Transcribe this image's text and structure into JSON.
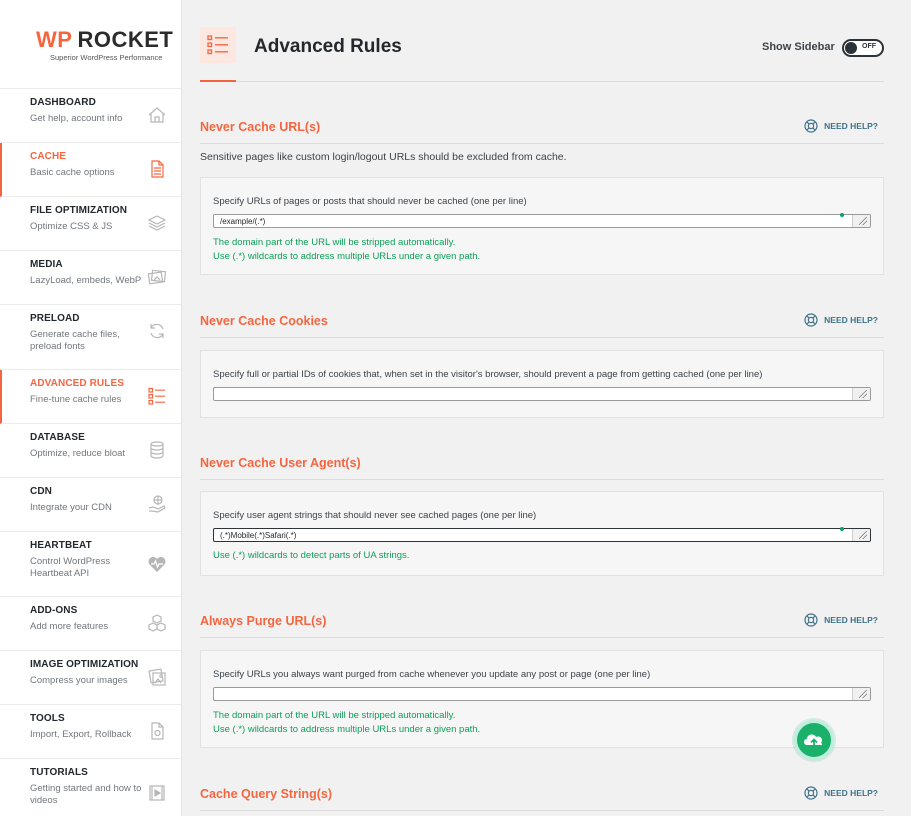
{
  "logo": {
    "brand_wp": "WP",
    "brand_rocket": "ROCKET",
    "tagline": "Superior WordPress Performance"
  },
  "sidebar": {
    "items": [
      {
        "title": "DASHBOARD",
        "desc": "Get help, account info",
        "icon": "home-icon"
      },
      {
        "title": "CACHE",
        "desc": "Basic cache options",
        "icon": "document-icon"
      },
      {
        "title": "FILE OPTIMIZATION",
        "desc": "Optimize CSS & JS",
        "icon": "layers-icon"
      },
      {
        "title": "MEDIA",
        "desc": "LazyLoad, embeds, WebP",
        "icon": "images-icon"
      },
      {
        "title": "PRELOAD",
        "desc": "Generate cache files, preload fonts",
        "icon": "refresh-icon"
      },
      {
        "title": "ADVANCED RULES",
        "desc": "Fine-tune cache rules",
        "icon": "checklist-icon"
      },
      {
        "title": "DATABASE",
        "desc": "Optimize, reduce bloat",
        "icon": "database-icon"
      },
      {
        "title": "CDN",
        "desc": "Integrate your CDN",
        "icon": "cdn-hand-icon"
      },
      {
        "title": "HEARTBEAT",
        "desc": "Control WordPress Heartbeat API",
        "icon": "heartbeat-icon"
      },
      {
        "title": "ADD-ONS",
        "desc": "Add more features",
        "icon": "cubes-icon"
      },
      {
        "title": "IMAGE OPTIMIZATION",
        "desc": "Compress your images",
        "icon": "image-optimize-icon"
      },
      {
        "title": "TOOLS",
        "desc": "Import, Export, Rollback",
        "icon": "tools-file-icon"
      },
      {
        "title": "TUTORIALS",
        "desc": "Getting started and how to videos",
        "icon": "video-icon"
      }
    ]
  },
  "header": {
    "title": "Advanced Rules",
    "show_sidebar_label": "Show Sidebar",
    "toggle_state": "OFF"
  },
  "help_label": "NEED HELP?",
  "sections": {
    "never_cache_urls": {
      "title": "Never Cache URL(s)",
      "desc": "Sensitive pages like custom login/logout URLs should be excluded from cache.",
      "field_label": "Specify URLs of pages or posts that should never be cached (one per line)",
      "value": "/example/(.*)",
      "note1": "The domain part of the URL will be stripped automatically.",
      "note2": "Use (.*) wildcards to address multiple URLs under a given path."
    },
    "never_cache_cookies": {
      "title": "Never Cache Cookies",
      "field_label": "Specify full or partial IDs of cookies that, when set in the visitor's browser, should prevent a page from getting cached (one per line)",
      "value": ""
    },
    "never_cache_user_agents": {
      "title": "Never Cache User Agent(s)",
      "field_label": "Specify user agent strings that should never see cached pages (one per line)",
      "value": "(.*)Mobile(.*)Safari(.*)",
      "note1": "Use (.*) wildcards to detect parts of UA strings."
    },
    "always_purge_urls": {
      "title": "Always Purge URL(s)",
      "field_label": "Specify URLs you always want purged from cache whenever you update any post or page (one per line)",
      "value": "",
      "note1": "The domain part of the URL will be stripped automatically.",
      "note2": "Use (.*) wildcards to address multiple URLs under a given path."
    },
    "cache_query_strings": {
      "title": "Cache Query String(s)"
    }
  },
  "colors": {
    "accent": "#f56640",
    "success": "#0b9f57",
    "help": "#40728a"
  }
}
